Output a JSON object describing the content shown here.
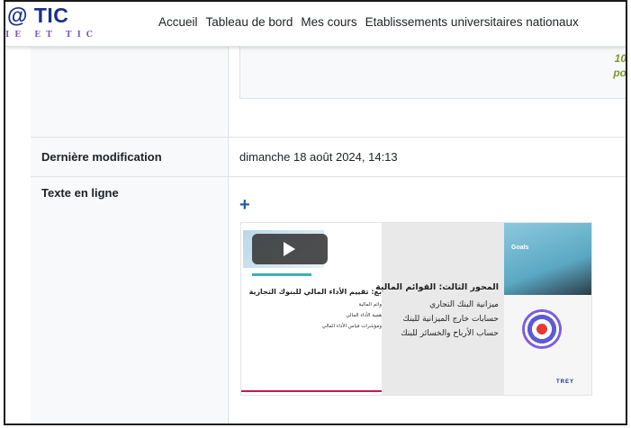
{
  "logo": {
    "main": "@ TIC",
    "sub": "IE ET TIC"
  },
  "nav": {
    "items": [
      "Accueil",
      "Tableau de bord",
      "Mes cours",
      "Etablissements universitaires nationaux"
    ]
  },
  "previous_row": {
    "green_line1": "10",
    "green_line2": "po"
  },
  "rows": {
    "last_modified": {
      "label": "Dernière modification",
      "value": "dimanche 18 août 2024, 14:13"
    },
    "online_text": {
      "label": "Texte en ligne",
      "add_symbol": "+"
    }
  },
  "slide": {
    "left_title": "بع: تقييم الأداء المالي للبنوك التجارية",
    "left_lines": [
      "وائم المالية",
      "همية الأداء المالي",
      "ومؤشرات قياس الأداء المالي"
    ],
    "center_title": "المحور الثالث: القوائم المالية",
    "center_bullets": [
      "ميزانية البنك التجاري",
      "حسابات خارج الميزانية للبنك",
      "حساب الأرباح والخسائر للبنك"
    ],
    "right_goals": "Goals",
    "right_brand": "TREY"
  }
}
